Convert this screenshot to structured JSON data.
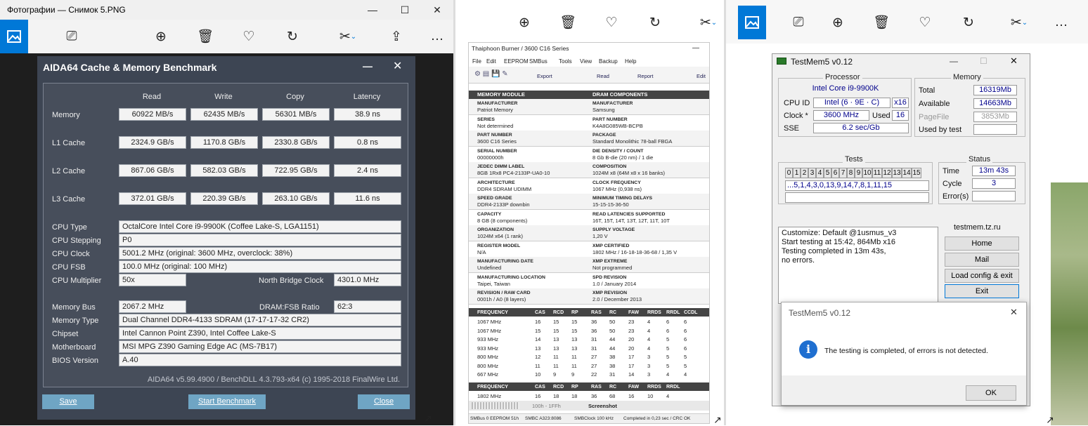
{
  "photos_left": {
    "title": "Фотографии — Снимок 5.PNG",
    "icons": [
      "photos-icon",
      "slideshow-icon",
      "zoom-icon",
      "delete-icon",
      "favorite-icon",
      "rotate-icon",
      "edit-icon",
      "share-icon",
      "more-icon"
    ],
    "more": "…",
    "min": "—",
    "max": "☐",
    "close": "✕"
  },
  "aida": {
    "title": "AIDA64 Cache & Memory Benchmark",
    "min": "—",
    "close": "✕",
    "columns": [
      "Read",
      "Write",
      "Copy",
      "Latency"
    ],
    "rows": [
      {
        "label": "Memory",
        "values": [
          "60922 MB/s",
          "62435 MB/s",
          "56301 MB/s",
          "38.9 ns"
        ]
      },
      {
        "label": "L1 Cache",
        "values": [
          "2324.9 GB/s",
          "1170.8 GB/s",
          "2330.8 GB/s",
          "0.8 ns"
        ]
      },
      {
        "label": "L2 Cache",
        "values": [
          "867.06 GB/s",
          "582.03 GB/s",
          "722.95 GB/s",
          "2.4 ns"
        ]
      },
      {
        "label": "L3 Cache",
        "values": [
          "372.01 GB/s",
          "220.39 GB/s",
          "263.10 GB/s",
          "11.6 ns"
        ]
      }
    ],
    "cpu_type_label": "CPU Type",
    "cpu_type": "OctalCore Intel Core i9-9900K  (Coffee Lake-S, LGA1151)",
    "cpu_stepping_label": "CPU Stepping",
    "cpu_stepping": "P0",
    "cpu_clock_label": "CPU Clock",
    "cpu_clock": "5001.2 MHz  (original: 3600 MHz, overclock: 38%)",
    "cpu_fsb_label": "CPU FSB",
    "cpu_fsb": "100.0 MHz  (original: 100 MHz)",
    "cpu_mult_label": "CPU Multiplier",
    "cpu_mult": "50x",
    "nb_clock_label": "North Bridge Clock",
    "nb_clock": "4301.0 MHz",
    "mem_bus_label": "Memory Bus",
    "mem_bus": "2067.2 MHz",
    "dram_fsb_label": "DRAM:FSB Ratio",
    "dram_fsb": "62:3",
    "mem_type_label": "Memory Type",
    "mem_type": "Dual Channel DDR4-4133 SDRAM  (17-17-17-32 CR2)",
    "chipset_label": "Chipset",
    "chipset": "Intel Cannon Point Z390, Intel Coffee Lake-S",
    "motherboard_label": "Motherboard",
    "motherboard": "MSI MPG Z390 Gaming Edge AC (MS-7B17)",
    "bios_label": "BIOS Version",
    "bios": "A.40",
    "footer": "AIDA64 v5.99.4900 / BenchDLL 4.3.793-x64  (c) 1995-2018 FinalWire Ltd.",
    "save": "Save",
    "start": "Start Benchmark",
    "close_btn": "Close"
  },
  "thai": {
    "title": "Thaiphoon Burner / 3600 C16 Series",
    "min": "—",
    "menu": [
      "File",
      "Edit",
      "EEPROM",
      "SMBus",
      "Tools",
      "View",
      "Backup",
      "Help"
    ],
    "toolbar": [
      "Export",
      "Read",
      "Report",
      "Edit"
    ],
    "hdr_left": "MEMORY MODULE",
    "hdr_right": "DRAM COMPONENTS",
    "left": [
      [
        "MANUFACTURER",
        "Patriot Memory"
      ],
      [
        "SERIES",
        "Not determined"
      ],
      [
        "PART NUMBER",
        "3600 C16 Series"
      ],
      [
        "SERIAL NUMBER",
        "00000000h"
      ],
      [
        "JEDEC DIMM LABEL",
        "8GB 1Rx8 PC4-2133P-UA0-10"
      ],
      [
        "ARCHITECTURE",
        "DDR4 SDRAM UDIMM"
      ],
      [
        "SPEED GRADE",
        "DDR4-2133P downbin"
      ],
      [
        "CAPACITY",
        "8 GB (8 components)"
      ],
      [
        "ORGANIZATION",
        "1024M x64 (1 rank)"
      ],
      [
        "REGISTER MODEL",
        "N/A"
      ],
      [
        "MANUFACTURING DATE",
        "Undefined"
      ],
      [
        "MANUFACTURING LOCATION",
        "Taipei, Taiwan"
      ],
      [
        "REVISION / RAW CARD",
        "0001h / A0 (8 layers)"
      ]
    ],
    "right": [
      [
        "MANUFACTURER",
        "Samsung"
      ],
      [
        "PART NUMBER",
        "K4A8G085WB-BCPB"
      ],
      [
        "PACKAGE",
        "Standard Monolithic 78-ball FBGA"
      ],
      [
        "DIE DENSITY / COUNT",
        "8 Gb B-die (20 nm) / 1 die"
      ],
      [
        "COMPOSITION",
        "1024M x8 (64M x8 x 16 banks)"
      ],
      [
        "CLOCK FREQUENCY",
        "1067 MHz (0,938 ns)"
      ],
      [
        "MINIMUM TIMING DELAYS",
        "15-15-15-36-50"
      ],
      [
        "READ LATENCIES SUPPORTED",
        "16T, 15T, 14T, 13T, 12T, 11T, 10T"
      ],
      [
        "SUPPLY VOLTAGE",
        "1,20 V"
      ],
      [
        "XMP CERTIFIED",
        "1802 MHz / 16-18-18-36-68 / 1,35 V"
      ],
      [
        "XMP EXTREME",
        "Not programmed"
      ],
      [
        "SPD REVISION",
        "1.0 / January 2014"
      ],
      [
        "XMP REVISION",
        "2.0 / December 2013"
      ]
    ],
    "timing_headers": [
      "FREQUENCY",
      "CAS",
      "RCD",
      "RP",
      "RAS",
      "RC",
      "FAW",
      "RRDS",
      "RRDL",
      "CCDL"
    ],
    "timing_rows": [
      [
        "1067 MHz",
        "16",
        "15",
        "15",
        "36",
        "50",
        "23",
        "4",
        "6",
        "6"
      ],
      [
        "1067 MHz",
        "15",
        "15",
        "15",
        "36",
        "50",
        "23",
        "4",
        "6",
        "6"
      ],
      [
        "933 MHz",
        "14",
        "13",
        "13",
        "31",
        "44",
        "20",
        "4",
        "5",
        "6"
      ],
      [
        "933 MHz",
        "13",
        "13",
        "13",
        "31",
        "44",
        "20",
        "4",
        "5",
        "6"
      ],
      [
        "800 MHz",
        "12",
        "11",
        "11",
        "27",
        "38",
        "17",
        "3",
        "5",
        "5"
      ],
      [
        "800 MHz",
        "11",
        "11",
        "11",
        "27",
        "38",
        "17",
        "3",
        "5",
        "5"
      ],
      [
        "667 MHz",
        "10",
        "9",
        "9",
        "22",
        "31",
        "14",
        "3",
        "4",
        "4"
      ]
    ],
    "xmp_headers": [
      "FREQUENCY",
      "CAS",
      "RCD",
      "RP",
      "RAS",
      "RC",
      "FAW",
      "RRDS",
      "RRDL"
    ],
    "xmp_row": [
      "1802 MHz",
      "16",
      "18",
      "18",
      "36",
      "68",
      "16",
      "10",
      "4"
    ],
    "addr": "100h - 1FFh",
    "screenshot": "Screenshot",
    "status": [
      "SMBus 0 EEPROM 51h",
      "SMBC A323:8086",
      "SMBClock 100 kHz",
      "Completed in 0,23 sec / CRC OK"
    ]
  },
  "tm5": {
    "title": "TestMem5 v0.12",
    "min": "—",
    "max": "☐",
    "close": "✕",
    "processor_label": "Processor",
    "processor": "Intel Core i9-9900K",
    "cpuid_label": "CPU ID",
    "cpuid": "Intel  (6 · 9E · C)",
    "cpuid_x": "x16",
    "clock_label": "Clock *",
    "clock": "3600 MHz",
    "used_label": "Used",
    "used": "16",
    "sse_label": "SSE",
    "sse": "6.2 sec/Gb",
    "memory_label": "Memory",
    "total_label": "Total",
    "total": "16319Mb",
    "avail_label": "Available",
    "avail": "14663Mb",
    "pagefile_label": "PageFile",
    "pagefile": "3853Mb",
    "usedby_label": "Used by test",
    "usedby": "",
    "tests_label": "Tests",
    "tests": [
      "0",
      "1",
      "2",
      "3",
      "4",
      "5",
      "6",
      "7",
      "8",
      "9",
      "10",
      "11",
      "12",
      "13",
      "14",
      "15"
    ],
    "sequence": "...5,1,4,3,0,13,9,14,7,8,1,11,15",
    "status_label": "Status",
    "time_label": "Time",
    "time": "13m 43s",
    "cycle_label": "Cycle",
    "cycle": "3",
    "errors_label": "Error(s)",
    "errors": "",
    "log": [
      "Customize: Default @1usmus_v3",
      "Start testing at 15:42, 864Mb x16",
      "Testing completed in 13m 43s,",
      "no errors."
    ],
    "site": "testmem.tz.ru",
    "home": "Home",
    "mail": "Mail",
    "load": "Load config & exit",
    "exit": "Exit"
  },
  "dialog": {
    "title": "TestMem5 v0.12",
    "close": "✕",
    "message": "The testing is completed, of errors is not detected.",
    "ok": "OK"
  },
  "colors": {
    "accent": "#0078d7",
    "aida_bg": "#3d4553",
    "aida_btn": "#6fa5c4",
    "tm_value": "#00008b"
  }
}
